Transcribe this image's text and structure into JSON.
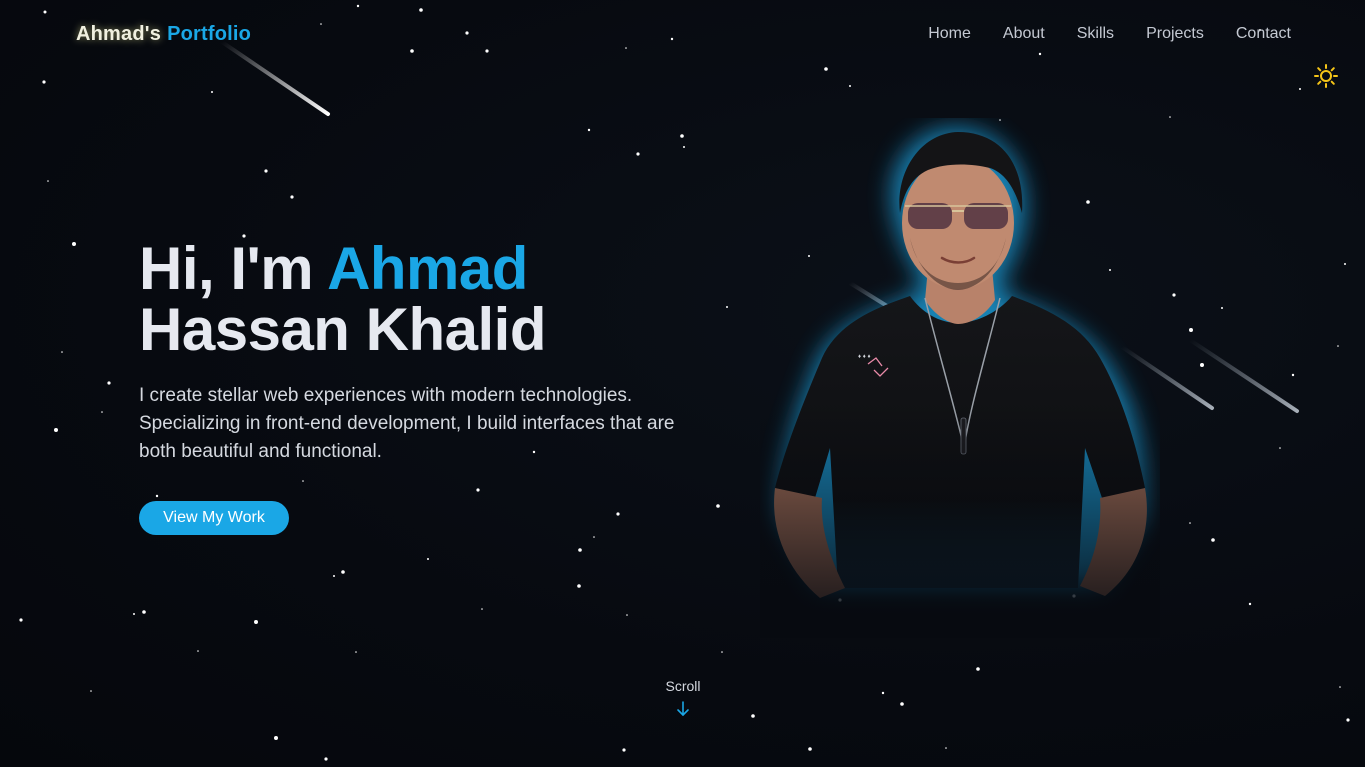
{
  "navbar": {
    "logo_first": "Ahmad's",
    "logo_second": "Portfolio",
    "links": [
      "Home",
      "About",
      "Skills",
      "Projects",
      "Contact"
    ]
  },
  "hero": {
    "greeting": "Hi, I'm ",
    "name_accent": "Ahmad",
    "name_rest": "Hassan Khalid",
    "description": "I create stellar web experiences with modern technologies. Specializing in front-end development, I build interfaces that are both beautiful and functional.",
    "cta_label": "View My Work"
  },
  "scroll": {
    "label": "Scroll"
  },
  "icons": {
    "theme_toggle": "sun-icon",
    "scroll": "arrow-down-icon",
    "profile": "profile-photo"
  },
  "colors": {
    "accent": "#1aa7e6",
    "background": "#070a10",
    "sun": "#f5c518",
    "heading": "#e6e9f0"
  }
}
